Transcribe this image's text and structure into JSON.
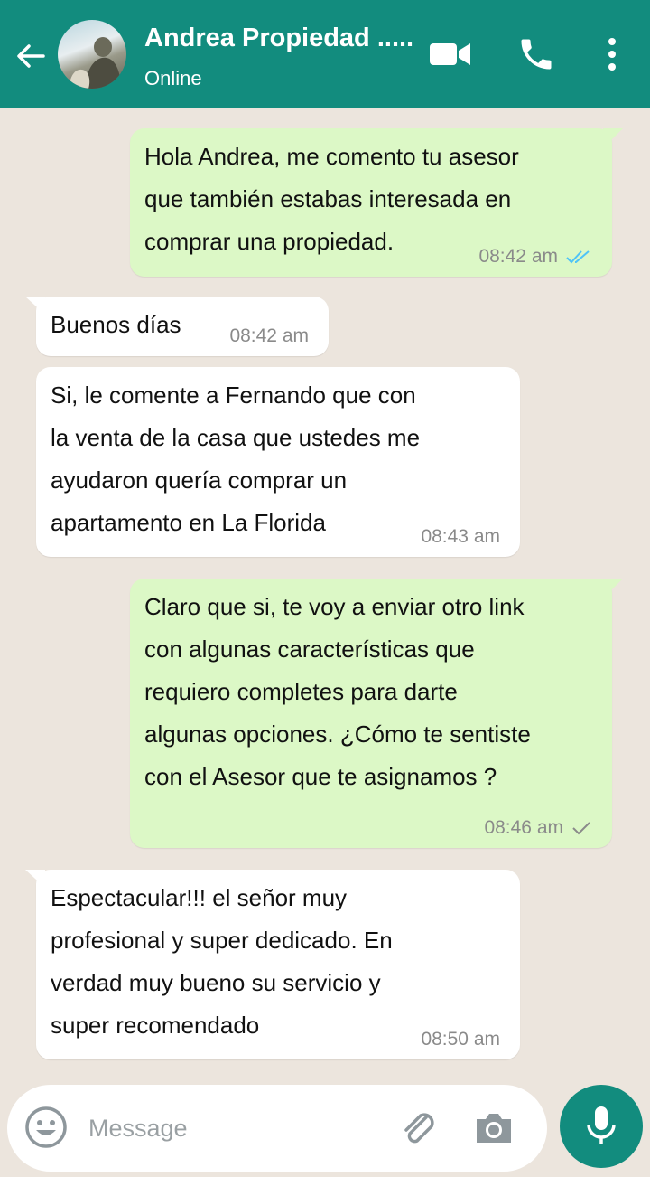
{
  "header": {
    "contact_name": "Andrea Propiedad .....",
    "status": "Online",
    "back_icon": "arrow-left-icon",
    "video_icon": "video-camera-icon",
    "call_icon": "phone-icon",
    "menu_icon": "more-vertical-icon"
  },
  "messages": [
    {
      "direction": "out",
      "text": " Hola Andrea, me comento tu asesor\nque también estabas interesada en\ncomprar una propiedad.",
      "time": "08:42 am",
      "ticks": "read"
    },
    {
      "direction": "in",
      "text": " Buenos días",
      "time": "08:42 am"
    },
    {
      "direction": "in",
      "text": "Si, le comente a Fernando que con\nla venta de la casa que ustedes me\nayudaron quería comprar un\napartamento en La Florida",
      "time": "08:43 am"
    },
    {
      "direction": "out",
      "text": " Claro que si, te voy a enviar otro link\ncon algunas características que\nrequiero completes para darte\nalgunas opciones. ¿Cómo te sentiste\ncon el Asesor que te asignamos ?",
      "time": "08:46 am",
      "ticks": "sent"
    },
    {
      "direction": "in",
      "text": " Espectacular!!! el señor muy\nprofesional y super dedicado. En\nverdad muy bueno su servicio y\nsuper recomendado",
      "time": "08:50 am"
    }
  ],
  "composer": {
    "placeholder": "Message",
    "value": "",
    "emoji_icon": "emoji-icon",
    "attach_icon": "paperclip-icon",
    "camera_icon": "camera-icon",
    "mic_icon": "microphone-icon"
  },
  "colors": {
    "header": "#128c7e",
    "outgoing_bubble": "#dcf8c6",
    "incoming_bubble": "#ffffff",
    "background": "#ece5dd",
    "read_ticks": "#4fc3f7"
  }
}
